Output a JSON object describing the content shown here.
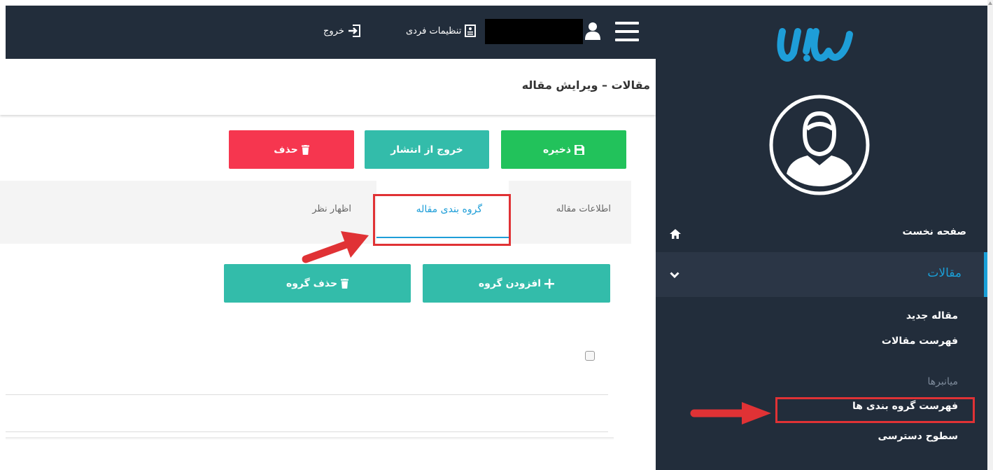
{
  "topbar": {
    "settings_label": "تنظیمات فردی",
    "logout_label": "خروج"
  },
  "header": {
    "title": "مقالات – ویرایش مقاله"
  },
  "toolbar": {
    "save_label": "ذخیره",
    "unpublish_label": "خروج از انتشار",
    "delete_label": "حذف"
  },
  "tabs": [
    {
      "label": "اطلاعات مقاله"
    },
    {
      "label": "گروه بندی مقاله"
    },
    {
      "label": "اظهار نظر"
    }
  ],
  "group_actions": {
    "add_label": "افزودن گروه",
    "delete_label": "حذف گروه"
  },
  "sidebar": {
    "home_label": "صفحه نخست",
    "articles_label": "مقالات",
    "submenu": [
      "مقاله جدید",
      "فهرست مقالات"
    ],
    "shortcuts_heading": "میانبرها",
    "shortcuts": [
      "فهرست گروه بندی ها",
      "سطوح دسترسی"
    ]
  },
  "colors": {
    "dark_bg": "#222d3b",
    "active_bg": "#2b3646",
    "accent_blue": "#1aa0d8",
    "save_green": "#22c25b",
    "teal": "#33bcaa",
    "delete_red": "#f6364f",
    "annotation_red": "#e03235"
  }
}
